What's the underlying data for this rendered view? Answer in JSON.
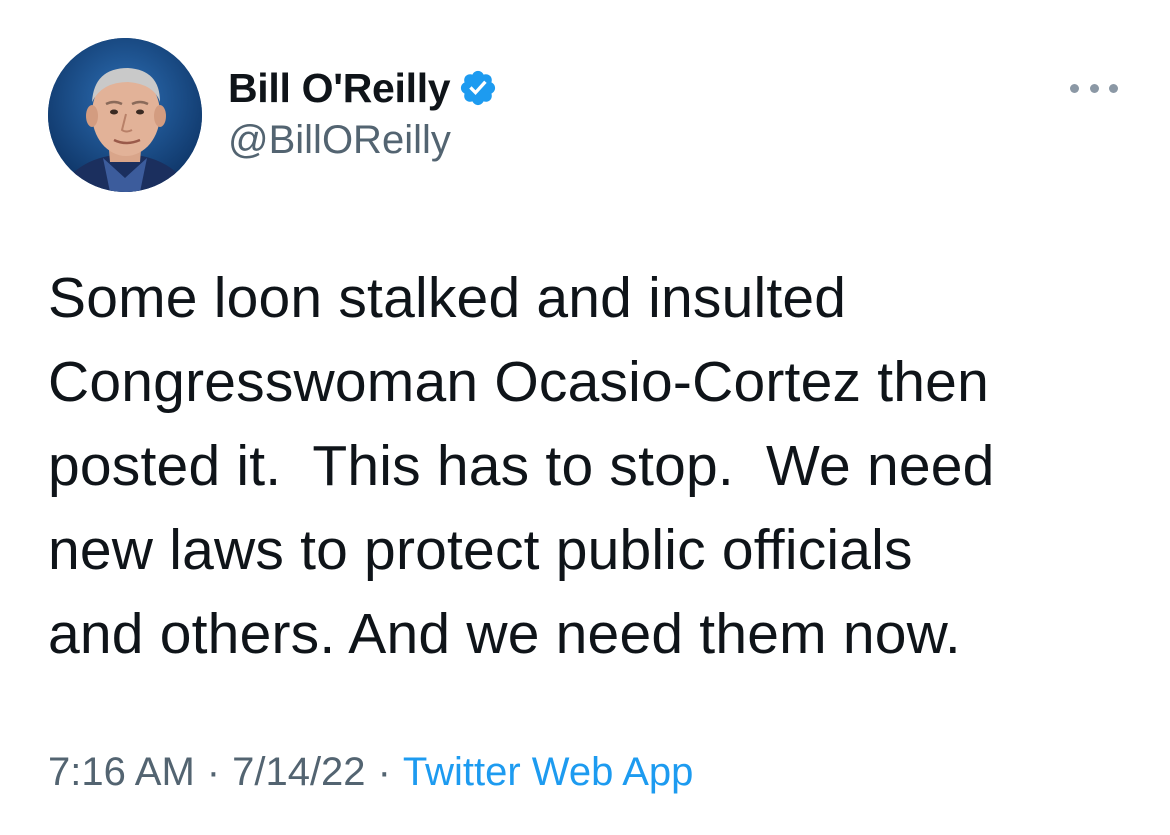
{
  "author": {
    "display_name": "Bill O'Reilly",
    "handle": "@BillOReilly",
    "verified": true,
    "avatar_icon": "profile-photo",
    "verified_icon": "verified-badge-icon"
  },
  "tweet": {
    "text": "Some loon stalked and insulted\nCongresswoman Ocasio-Cortez then\nposted it.  This has to stop.  We need\nnew laws to protect public officials\nand others. And we need them now.",
    "time": "7:16 AM",
    "date": "7/14/22",
    "separator": "·",
    "source": "Twitter Web App"
  },
  "menu": {
    "icon": "more-icon"
  },
  "colors": {
    "text_primary": "#0f1419",
    "text_secondary": "#536471",
    "accent": "#1d9bf0"
  }
}
